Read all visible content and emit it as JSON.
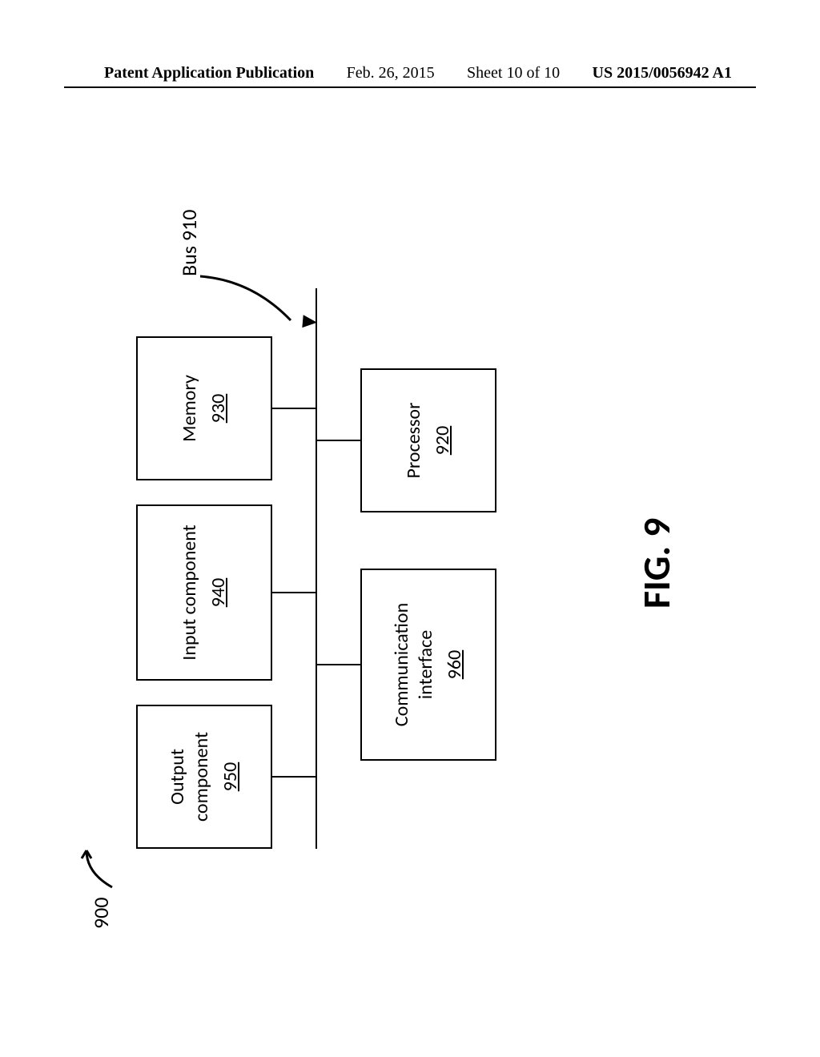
{
  "header": {
    "publication_label": "Patent Application Publication",
    "date": "Feb. 26, 2015",
    "sheet": "Sheet 10 of 10",
    "pubnum": "US 2015/0056942 A1"
  },
  "diagram": {
    "id_label": "900",
    "bus": {
      "label": "Bus 910"
    },
    "blocks": {
      "output": {
        "title": "Output component",
        "ref": "950"
      },
      "input": {
        "title": "Input component",
        "ref": "940"
      },
      "memory": {
        "title": "Memory",
        "ref": "930"
      },
      "comm": {
        "title": "Communication interface",
        "ref": "960"
      },
      "proc": {
        "title": "Processor",
        "ref": "920"
      }
    },
    "figure_caption": "FIG. 9"
  }
}
